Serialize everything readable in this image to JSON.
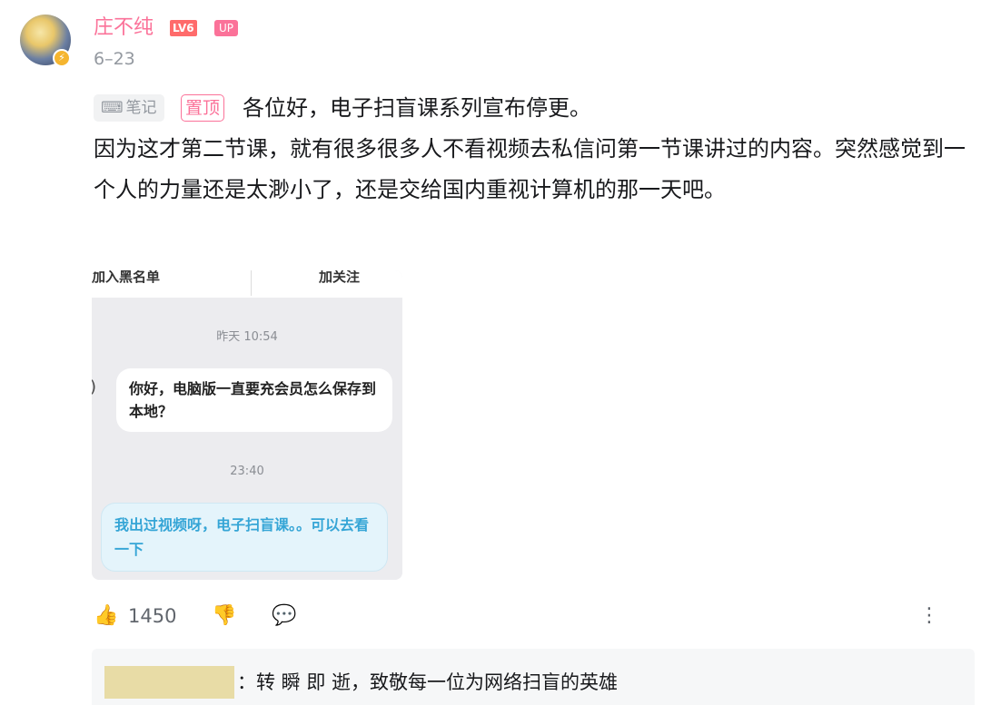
{
  "user": {
    "name": "庄不纯",
    "level_badge": "LV6",
    "up_badge": "UP",
    "date": "6–23"
  },
  "post": {
    "note_tag": "笔记",
    "pin_tag": "置顶",
    "line1": "各位好，电子扫盲课系列宣布停更。",
    "line2": "因为这才第二节课，就有很多很多人不看视频去私信问第一节课讲过的内容。突然感觉到一个人的力量还是太渺小了，还是交给国内重视计算机的那一天吧。"
  },
  "screenshot": {
    "top_left": "加入黑名单",
    "top_right": "加关注",
    "time1": "昨天 10:54",
    "incoming": "你好，电脑版一直要充会员怎么保存到本地？",
    "time2": "23:40",
    "outgoing": "我出过视频呀，电子扫盲课。。可以去看一下"
  },
  "actions": {
    "like_count": "1450"
  },
  "reply": {
    "text": "：转 瞬 即 逝，致敬每一位为网络扫盲的英雄"
  }
}
